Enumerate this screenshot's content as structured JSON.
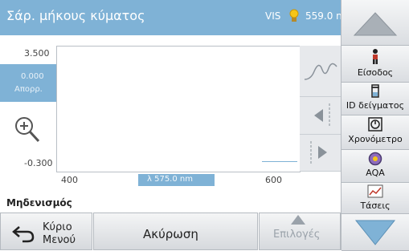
{
  "header": {
    "title": "Σάρ. μήκους κύματος",
    "mode": "VIS",
    "wavelength": "559.0 nm",
    "color": "#7fb2d6"
  },
  "plot": {
    "y_max": "3.500",
    "y_min": "-0.300",
    "current_value": "0.000",
    "unit": "Απορρ.",
    "x_start": "400",
    "x_end": "600",
    "cursor_wavelength": "λ 575.0 nm"
  },
  "status": {
    "label": "Μηδενισμός"
  },
  "bottom_bar": {
    "home_line1": "Κύριο",
    "home_line2": "Μενού",
    "cancel": "Ακύρωση",
    "options": "Επιλογές"
  },
  "sidebar": {
    "items": [
      {
        "label": "Είσοδος",
        "icon": "person-icon"
      },
      {
        "label": "ID δείγματος",
        "icon": "sample-vial-icon"
      },
      {
        "label": "Χρονόμετρο",
        "icon": "timer-icon"
      },
      {
        "label": "AQA",
        "icon": "aqa-icon"
      },
      {
        "label": "Τάσεις",
        "icon": "trend-chart-icon"
      }
    ]
  }
}
